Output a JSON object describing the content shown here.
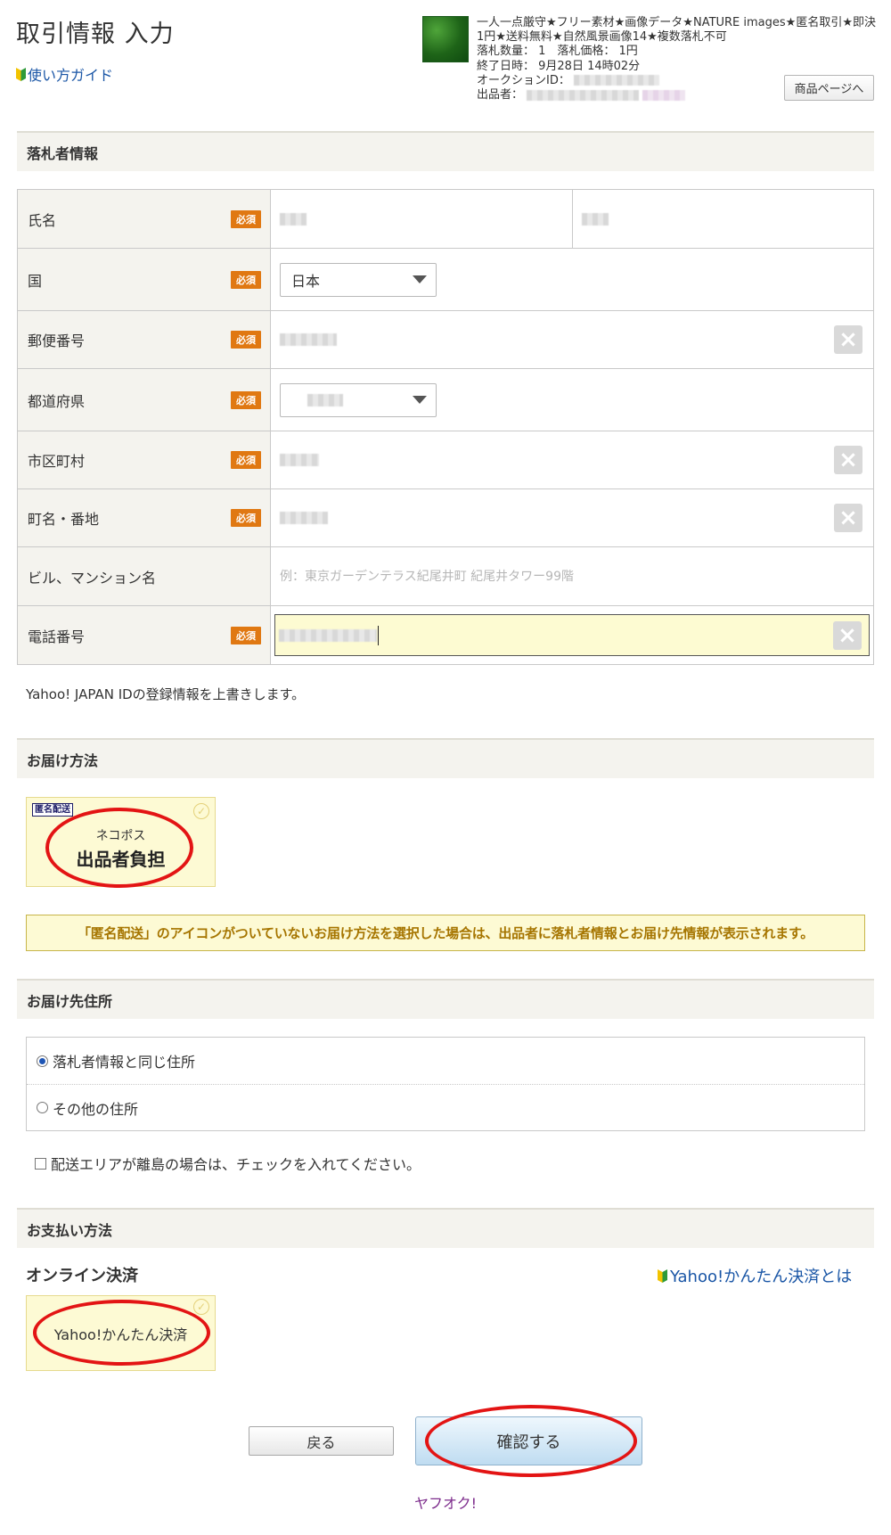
{
  "header": {
    "page_title": "取引情報 入力",
    "guide_link": "使い方ガイド",
    "item_title": "一人一点厳守★フリー素材★画像データ★NATURE images★匿名取引★即決1円★送料無料★自然風景画像14★複数落札不可",
    "quantity_line": "落札数量： 1　落札価格： 1円",
    "end_time_line": "終了日時： 9月28日 14時02分",
    "auction_id_label": "オークションID：",
    "seller_label": "出品者：",
    "product_page_button": "商品ページへ"
  },
  "winner_section": {
    "title": "落札者情報",
    "required_badge": "必須",
    "fields": {
      "name": "氏名",
      "country": "国",
      "country_value": "日本",
      "postal": "郵便番号",
      "prefecture": "都道府県",
      "city": "市区町村",
      "street": "町名・番地",
      "building": "ビル、マンション名",
      "building_placeholder": "例：東京ガーデンテラス紀尾井町 紀尾井タワー99階",
      "phone": "電話番号"
    },
    "overwrite_note": "Yahoo! JAPAN IDの登録情報を上書きします。"
  },
  "delivery_section": {
    "title": "お届け方法",
    "anon_badge": "匿名配送",
    "method_name": "ネコポス",
    "method_fee": "出品者負担",
    "notice": "「匿名配送」のアイコンがついていないお届け方法を選択した場合は、出品者に落札者情報とお届け先情報が表示されます。"
  },
  "address_section": {
    "title": "お届け先住所",
    "option_same": "落札者情報と同じ住所",
    "option_other": "その他の住所",
    "island_check": "配送エリアが離島の場合は、チェックを入れてください。"
  },
  "payment_section": {
    "title": "お支払い方法",
    "online_label": "オンライン決済",
    "easy_pay_link": "Yahoo!かんたん決済とは",
    "method_name": "Yahoo!かんたん決済"
  },
  "actions": {
    "back": "戻る",
    "confirm": "確認する"
  },
  "footer": {
    "logo_text": "ヤフオク!"
  },
  "colors": {
    "accent_link": "#1a56a6",
    "required_badge": "#e07812",
    "highlight_yellow": "#fdfad4",
    "annotation_red": "#e31414",
    "footer_purple": "#7d2c8c"
  },
  "icons": {
    "guide": "beginner-mark-icon",
    "clear": "close-icon",
    "dropdown": "chevron-down-icon",
    "selected": "check-circle-icon"
  }
}
